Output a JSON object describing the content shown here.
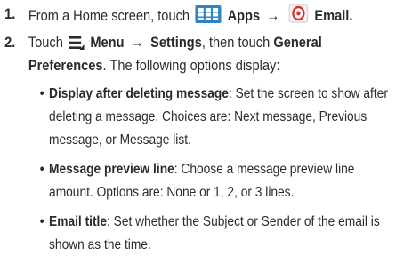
{
  "colors": {
    "text": "#2b2b2b",
    "apps_icon": "#2e84c4",
    "email_icon_ring": "#d9302b"
  },
  "steps": [
    {
      "number": "1.",
      "text1": "From a Home screen, touch",
      "apps_label": "Apps",
      "arrow": "→",
      "email_label": "Email",
      "period": ".",
      "icons": [
        "apps-grid-icon",
        "email-icon"
      ]
    },
    {
      "number": "2.",
      "text1": "Touch",
      "menu_label": "Menu",
      "arrow": "→",
      "settings_label": "Settings",
      "text2": ", then touch",
      "general_label": "General",
      "line2_bold": "Preferences",
      "line2_rest": ". The following options display:",
      "icons": [
        "menu-icon"
      ]
    }
  ],
  "bullets": [
    {
      "dot": "•",
      "term": "Display after deleting message",
      "lines": [
        ": Set the screen to show after",
        "deleting a message. Choices are: Next message, Previous",
        "message, or Message list."
      ]
    },
    {
      "dot": "•",
      "term": "Message preview line",
      "lines": [
        ": Choose a message preview line",
        "amount. Options are: None or 1, 2, or 3 lines."
      ]
    },
    {
      "dot": "•",
      "term": "Email title",
      "lines": [
        ": Set whether the Subject or Sender of the email is",
        "shown as the time."
      ]
    }
  ]
}
